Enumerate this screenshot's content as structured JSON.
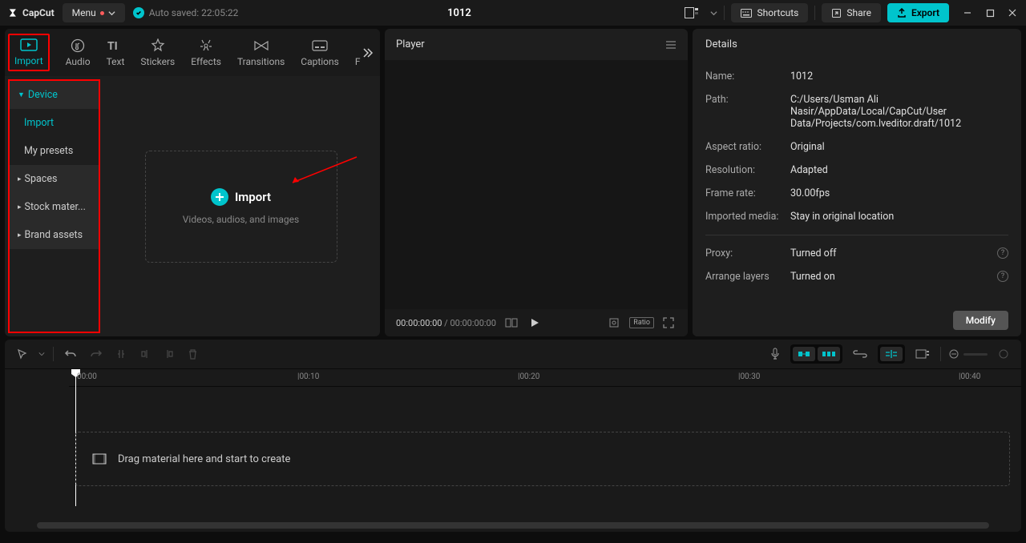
{
  "titlebar": {
    "logo": "CapCut",
    "menu": "Menu",
    "autosave": "Auto saved: 22:05:22",
    "project": "1012",
    "shortcuts": "Shortcuts",
    "share": "Share",
    "export": "Export"
  },
  "tabs": [
    {
      "id": "import",
      "label": "Import"
    },
    {
      "id": "audio",
      "label": "Audio"
    },
    {
      "id": "text",
      "label": "Text"
    },
    {
      "id": "stickers",
      "label": "Stickers"
    },
    {
      "id": "effects",
      "label": "Effects"
    },
    {
      "id": "transitions",
      "label": "Transitions"
    },
    {
      "id": "captions",
      "label": "Captions"
    },
    {
      "id": "f",
      "label": "F"
    }
  ],
  "sidebar": [
    {
      "id": "device",
      "label": "Device",
      "header": true,
      "active": true,
      "expanded": true
    },
    {
      "id": "import",
      "label": "Import",
      "active": true
    },
    {
      "id": "presets",
      "label": "My presets"
    },
    {
      "id": "spaces",
      "label": "Spaces",
      "header": true
    },
    {
      "id": "stock",
      "label": "Stock mater...",
      "header": true
    },
    {
      "id": "brand",
      "label": "Brand assets",
      "header": true
    }
  ],
  "import_box": {
    "label": "Import",
    "sub": "Videos, audios, and images"
  },
  "player": {
    "title": "Player",
    "time_current": "00:00:00:00",
    "time_total": "00:00:00:00",
    "ratio": "Ratio"
  },
  "details": {
    "title": "Details",
    "rows": [
      {
        "label": "Name:",
        "value": "1012"
      },
      {
        "label": "Path:",
        "value": "C:/Users/Usman Ali Nasir/AppData/Local/CapCut/User Data/Projects/com.lveditor.draft/1012"
      },
      {
        "label": "Aspect ratio:",
        "value": "Original"
      },
      {
        "label": "Resolution:",
        "value": "Adapted"
      },
      {
        "label": "Frame rate:",
        "value": "30.00fps"
      },
      {
        "label": "Imported media:",
        "value": "Stay in original location"
      }
    ],
    "rows2": [
      {
        "label": "Proxy:",
        "value": "Turned off",
        "info": true
      },
      {
        "label": "Arrange layers",
        "value": "Turned on",
        "info": true
      }
    ],
    "modify": "Modify"
  },
  "timeline": {
    "ticks": [
      "00:00",
      "|00:10",
      "|00:20",
      "|00:30",
      "|00:40"
    ],
    "drop_hint": "Drag material here and start to create"
  }
}
